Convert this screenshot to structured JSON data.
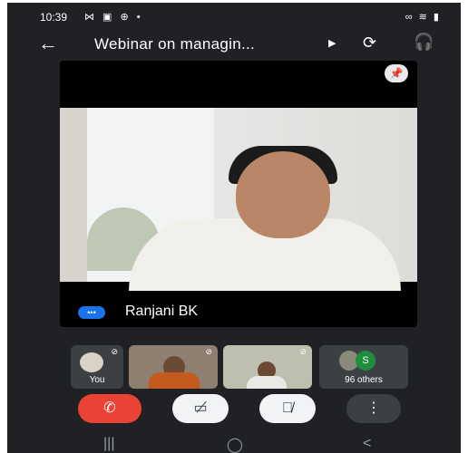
{
  "status_bar": {
    "time": "10:39",
    "left_icons": "⋈ ▣ ⊕ •",
    "right_icons": "∞ ≋ ▮"
  },
  "header": {
    "back_icon": "arrow-left-icon",
    "title": "Webinar on managin...",
    "switch_camera_icon": "switch-camera-icon",
    "audio_icon": "headphones-icon"
  },
  "main_tile": {
    "speaker_name": "Ranjani BK",
    "pin_icon": "pin-icon",
    "speaking_icon": "speaking-indicator-icon"
  },
  "thumbnails": [
    {
      "label": "You",
      "muted": true
    },
    {
      "label": "",
      "muted": true
    },
    {
      "label": "",
      "muted": true
    },
    {
      "label": "96 others",
      "initial": "S"
    }
  ],
  "controls": {
    "end_call_icon": "phone-hangup-icon",
    "camera_icon": "camera-off-icon",
    "mic_icon": "mic-off-icon",
    "more_icon": "more-vert-icon"
  },
  "colors": {
    "background": "#202124",
    "end_call": "#ea4335",
    "accent": "#1a73e8",
    "others_badge": "#1e8e3e"
  }
}
